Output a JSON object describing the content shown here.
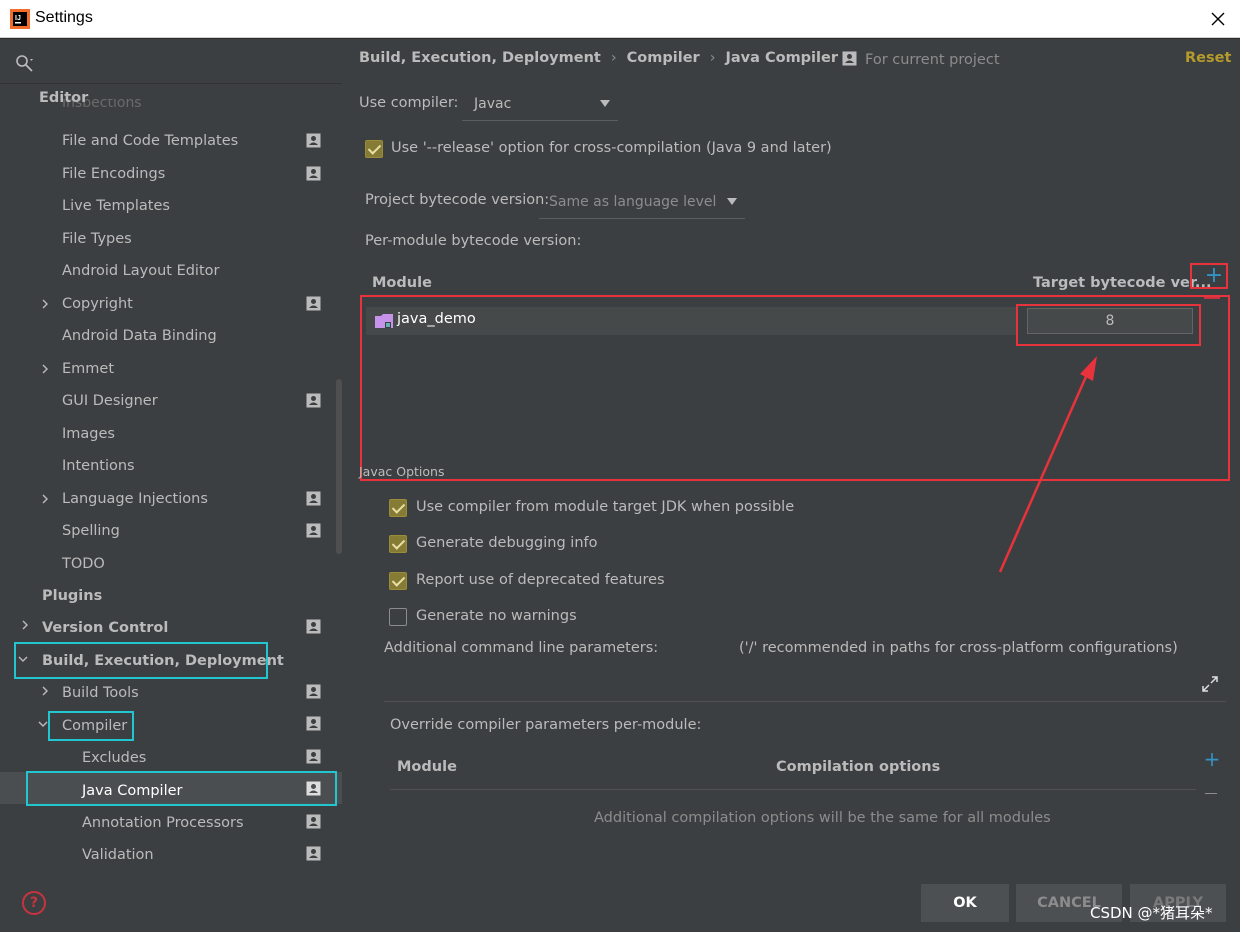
{
  "window": {
    "title": "Settings"
  },
  "sidebar": {
    "cut_item": "Inspections",
    "sections": {
      "editor": "Editor",
      "plugins": "Plugins"
    },
    "editor_items": [
      {
        "label": "File and Code Templates",
        "project": true
      },
      {
        "label": "File Encodings",
        "project": true
      },
      {
        "label": "Live Templates",
        "project": false
      },
      {
        "label": "File Types",
        "project": false
      },
      {
        "label": "Android Layout Editor",
        "project": false
      },
      {
        "label": "Copyright",
        "project": true,
        "expandable": true
      },
      {
        "label": "Android Data Binding",
        "project": false
      },
      {
        "label": "Emmet",
        "project": false,
        "expandable": true
      },
      {
        "label": "GUI Designer",
        "project": true
      },
      {
        "label": "Images",
        "project": false
      },
      {
        "label": "Intentions",
        "project": false
      },
      {
        "label": "Language Injections",
        "project": true,
        "expandable": true
      },
      {
        "label": "Spelling",
        "project": true
      },
      {
        "label": "TODO",
        "project": false
      }
    ],
    "version_control": "Version Control",
    "build": "Build, Execution, Deployment",
    "build_tools": "Build Tools",
    "compiler": "Compiler",
    "excludes": "Excludes",
    "java_compiler": "Java Compiler",
    "annotation_processors": "Annotation Processors",
    "validation": "Validation",
    "help": "?"
  },
  "main": {
    "breadcrumb": [
      "Build, Execution, Deployment",
      "Compiler",
      "Java Compiler"
    ],
    "breadcrumb_sep": "›",
    "for_current_project": "For current project",
    "reset": "Reset",
    "use_compiler_label": "Use compiler:",
    "use_compiler_value": "Javac",
    "release_option": "Use '--release' option for cross-compilation (Java 9 and later)",
    "project_bytecode_label": "Project bytecode version:",
    "project_bytecode_value": "Same as language level",
    "per_module_label": "Per-module bytecode version:",
    "module_table": {
      "col_module": "Module",
      "col_target": "Target bytecode ver...",
      "rows": [
        {
          "module": "java_demo",
          "target": "8"
        }
      ]
    },
    "javac_options_title": "Javac Options",
    "javac_options": [
      {
        "label": "Use compiler from module target JDK when possible",
        "checked": true
      },
      {
        "label": "Generate debugging info",
        "checked": true
      },
      {
        "label": "Report use of deprecated features",
        "checked": true
      },
      {
        "label": "Generate no warnings",
        "checked": false
      }
    ],
    "additional_params_label": "Additional command line parameters:",
    "additional_params_hint": "('/' recommended in paths for cross-platform configurations)",
    "override_label": "Override compiler parameters per-module:",
    "override_table": {
      "col_module": "Module",
      "col_options": "Compilation options",
      "empty": "Additional compilation options will be the same for all modules"
    },
    "plus": "+",
    "buttons": {
      "ok": "OK",
      "cancel": "CANCEL",
      "apply": "APPLY"
    }
  },
  "watermark": "CSDN @*猪耳朵*",
  "colors": {
    "accent_cyan": "#22c6d0",
    "annotation_red": "#e8323c",
    "checkbox": "#857b34",
    "reset": "#b59b2c",
    "link_blue": "#3592c4"
  }
}
